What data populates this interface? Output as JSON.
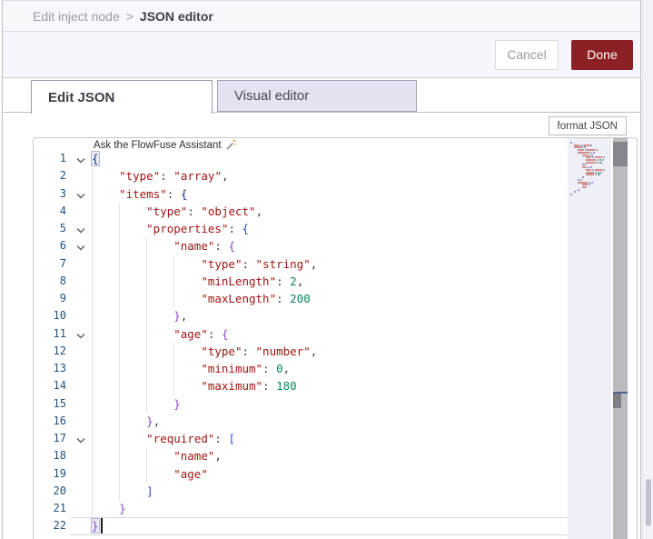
{
  "breadcrumb": {
    "parent": "Edit inject node",
    "separator": ">",
    "current": "JSON editor"
  },
  "actions": {
    "cancel_label": "Cancel",
    "done_label": "Done"
  },
  "tabs": [
    {
      "label": "Edit JSON",
      "active": true
    },
    {
      "label": "Visual editor",
      "active": false
    }
  ],
  "toolbar": {
    "format_button_label": "format JSON"
  },
  "editor": {
    "assistant_hint": "Ask the FlowFuse Assistant",
    "language": "json",
    "cursor_line": 22,
    "lines": [
      {
        "n": 1,
        "indent": 0,
        "fold": true,
        "tokens": [
          {
            "t": "{",
            "c": "bD",
            "box": true
          }
        ]
      },
      {
        "n": 2,
        "indent": 4,
        "tokens": [
          {
            "t": "\"type\"",
            "c": "key"
          },
          {
            "t": ": ",
            "c": "pn"
          },
          {
            "t": "\"array\"",
            "c": "str"
          },
          {
            "t": ",",
            "c": "pn"
          }
        ]
      },
      {
        "n": 3,
        "indent": 4,
        "fold": true,
        "tokens": [
          {
            "t": "\"items\"",
            "c": "key"
          },
          {
            "t": ": ",
            "c": "pn"
          },
          {
            "t": "{",
            "c": "bD"
          }
        ]
      },
      {
        "n": 4,
        "indent": 8,
        "tokens": [
          {
            "t": "\"type\"",
            "c": "key"
          },
          {
            "t": ": ",
            "c": "pn"
          },
          {
            "t": "\"object\"",
            "c": "str"
          },
          {
            "t": ",",
            "c": "pn"
          }
        ]
      },
      {
        "n": 5,
        "indent": 8,
        "fold": true,
        "tokens": [
          {
            "t": "\"properties\"",
            "c": "key"
          },
          {
            "t": ": ",
            "c": "pn"
          },
          {
            "t": "{",
            "c": "bB"
          }
        ]
      },
      {
        "n": 6,
        "indent": 12,
        "fold": true,
        "tokens": [
          {
            "t": "\"name\"",
            "c": "key"
          },
          {
            "t": ": ",
            "c": "pn"
          },
          {
            "t": "{",
            "c": "bP"
          }
        ]
      },
      {
        "n": 7,
        "indent": 16,
        "tokens": [
          {
            "t": "\"type\"",
            "c": "key"
          },
          {
            "t": ": ",
            "c": "pn"
          },
          {
            "t": "\"string\"",
            "c": "str"
          },
          {
            "t": ",",
            "c": "pn"
          }
        ]
      },
      {
        "n": 8,
        "indent": 16,
        "tokens": [
          {
            "t": "\"minLength\"",
            "c": "key"
          },
          {
            "t": ": ",
            "c": "pn"
          },
          {
            "t": "2",
            "c": "num"
          },
          {
            "t": ",",
            "c": "pn"
          }
        ]
      },
      {
        "n": 9,
        "indent": 16,
        "tokens": [
          {
            "t": "\"maxLength\"",
            "c": "key"
          },
          {
            "t": ": ",
            "c": "pn"
          },
          {
            "t": "200",
            "c": "num"
          }
        ]
      },
      {
        "n": 10,
        "indent": 12,
        "tokens": [
          {
            "t": "}",
            "c": "bP"
          },
          {
            "t": ",",
            "c": "pn"
          }
        ]
      },
      {
        "n": 11,
        "indent": 12,
        "fold": true,
        "tokens": [
          {
            "t": "\"age\"",
            "c": "key"
          },
          {
            "t": ": ",
            "c": "pn"
          },
          {
            "t": "{",
            "c": "bP"
          }
        ]
      },
      {
        "n": 12,
        "indent": 16,
        "tokens": [
          {
            "t": "\"type\"",
            "c": "key"
          },
          {
            "t": ": ",
            "c": "pn"
          },
          {
            "t": "\"number\"",
            "c": "str"
          },
          {
            "t": ",",
            "c": "pn"
          }
        ]
      },
      {
        "n": 13,
        "indent": 16,
        "tokens": [
          {
            "t": "\"minimum\"",
            "c": "key"
          },
          {
            "t": ": ",
            "c": "pn"
          },
          {
            "t": "0",
            "c": "num"
          },
          {
            "t": ",",
            "c": "pn"
          }
        ]
      },
      {
        "n": 14,
        "indent": 16,
        "tokens": [
          {
            "t": "\"maximum\"",
            "c": "key"
          },
          {
            "t": ": ",
            "c": "pn"
          },
          {
            "t": "180",
            "c": "num"
          }
        ]
      },
      {
        "n": 15,
        "indent": 12,
        "tokens": [
          {
            "t": "}",
            "c": "bP"
          }
        ]
      },
      {
        "n": 16,
        "indent": 8,
        "tokens": [
          {
            "t": "}",
            "c": "bP"
          },
          {
            "t": ",",
            "c": "pn"
          }
        ]
      },
      {
        "n": 17,
        "indent": 8,
        "fold": true,
        "tokens": [
          {
            "t": "\"required\"",
            "c": "key"
          },
          {
            "t": ": ",
            "c": "pn"
          },
          {
            "t": "[",
            "c": "bB"
          }
        ]
      },
      {
        "n": 18,
        "indent": 12,
        "tokens": [
          {
            "t": "\"name\"",
            "c": "str"
          },
          {
            "t": ",",
            "c": "pn"
          }
        ]
      },
      {
        "n": 19,
        "indent": 12,
        "tokens": [
          {
            "t": "\"age\"",
            "c": "str"
          }
        ]
      },
      {
        "n": 20,
        "indent": 8,
        "tokens": [
          {
            "t": "]",
            "c": "bB"
          }
        ]
      },
      {
        "n": 21,
        "indent": 4,
        "tokens": [
          {
            "t": "}",
            "c": "bP"
          }
        ]
      },
      {
        "n": 22,
        "indent": 0,
        "current": true,
        "cursor": true,
        "tokens": [
          {
            "t": "}",
            "c": "bP",
            "box": true
          }
        ]
      }
    ]
  },
  "colors": {
    "done_button": "#8c2025",
    "code_key": "#a31515",
    "code_string": "#a31515",
    "code_number": "#098658",
    "bracket_dark_blue": "#1b2e8a",
    "bracket_blue": "#2b46d9",
    "bracket_purple": "#8747d1",
    "line_number": "#25537c"
  }
}
